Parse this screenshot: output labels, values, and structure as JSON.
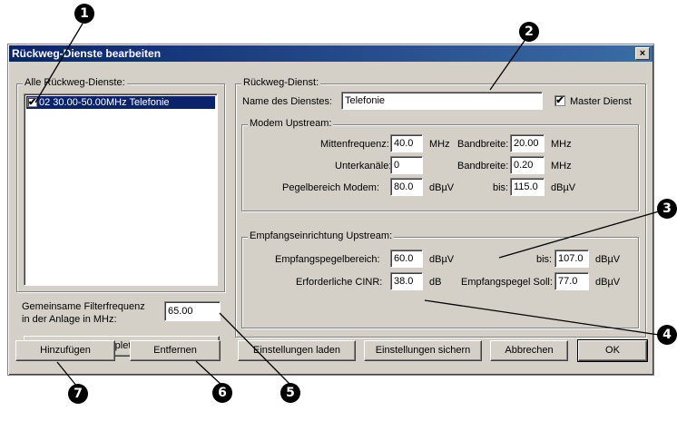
{
  "window": {
    "title": "Rückweg-Dienste bearbeiten",
    "close": "×"
  },
  "callouts": [
    "1",
    "2",
    "3",
    "4",
    "5",
    "6",
    "7"
  ],
  "left": {
    "group_title": "Alle Rückweg-Dienste:",
    "list_items": [
      {
        "label": "02 30.00-50.00MHz Telefonie",
        "checked": "✔"
      }
    ],
    "filter_label_line1": "Gemeinsame Filterfrequenz",
    "filter_label_line2": "in der Anlage in MHz:",
    "filter_value": "65.00",
    "clear_button": "Liste komplett löschen",
    "add_button": "Hinzufügen",
    "remove_button": "Entfernen"
  },
  "right": {
    "group_title": "Rückweg-Dienst:",
    "name_label": "Name des Dienstes:",
    "name_value": "Telefonie",
    "master_label": "Master Dienst",
    "master_checked": "✔",
    "modem": {
      "title": "Modem Upstream:",
      "mitten_label": "Mittenfrequenz:",
      "mitten_value": "40.0",
      "mitten_unit": "MHz",
      "bandbreite1_label": "Bandbreite:",
      "bandbreite1_value": "20.00",
      "bandbreite1_unit": "MHz",
      "unterkanaele_label": "Unterkanäle:",
      "unterkanaele_value": "0",
      "bandbreite2_label": "Bandbreite:",
      "bandbreite2_value": "0.20",
      "bandbreite2_unit": "MHz",
      "pegel_label": "Pegelbereich Modem:",
      "pegel_value": "80.0",
      "pegel_unit": "dBµV",
      "bis_label": "bis:",
      "bis_value": "115.0",
      "bis_unit": "dBµV"
    },
    "empfang": {
      "title": "Empfangseinrichtung Upstream:",
      "pegel_label": "Empfangspegelbereich:",
      "pegel_value": "60.0",
      "pegel_unit": "dBµV",
      "bis_label": "bis:",
      "bis_value": "107.0",
      "bis_unit": "dBµV",
      "cinr_label": "Erforderliche CINR:",
      "cinr_value": "38.0",
      "cinr_unit": "dB",
      "soll_label": "Empfangspegel Soll:",
      "soll_value": "77.0",
      "soll_unit": "dBµV"
    }
  },
  "bottom": {
    "load_button": "Einstellungen laden",
    "save_button": "Einstellungen sichern",
    "cancel_button": "Abbrechen",
    "ok_button": "OK"
  }
}
